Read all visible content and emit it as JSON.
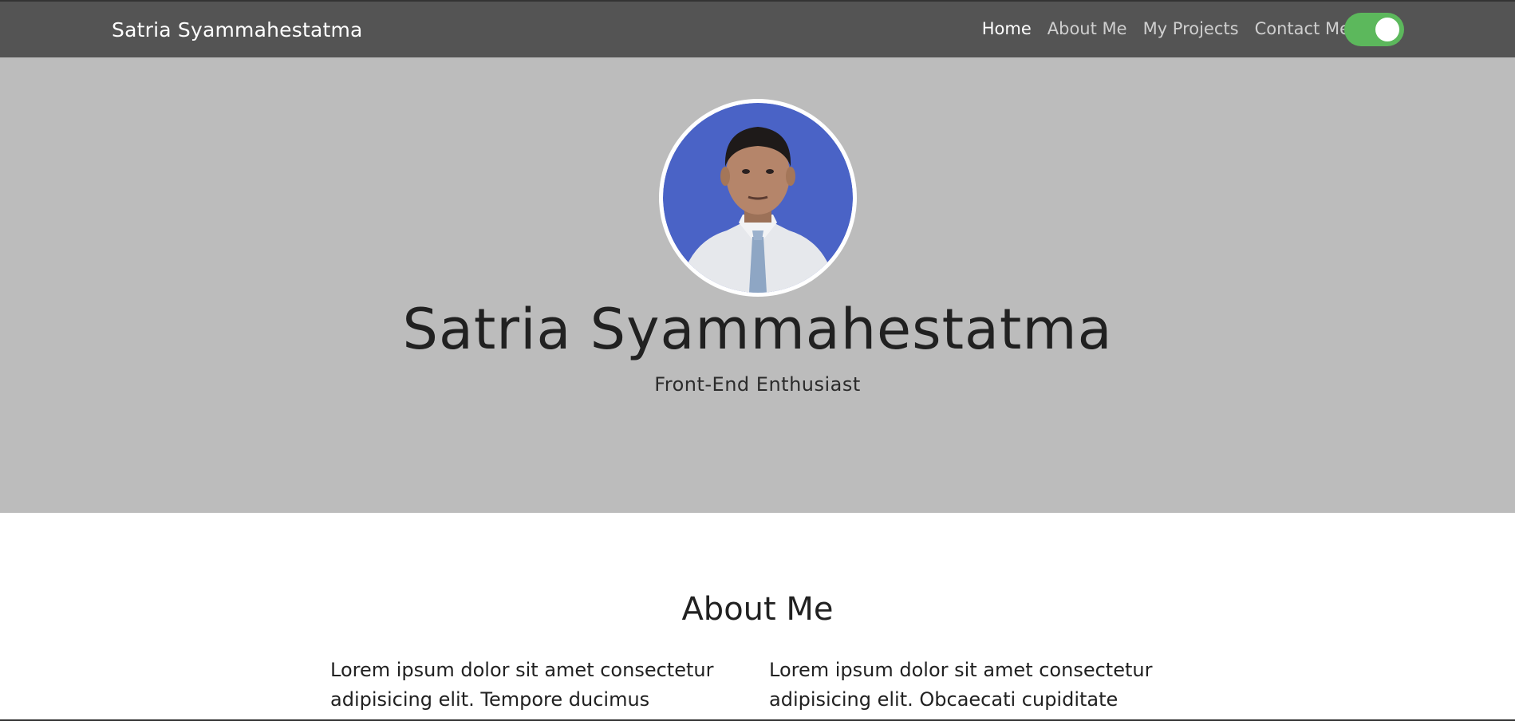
{
  "navbar": {
    "brand": "Satria Syammahestatma",
    "links": [
      {
        "label": "Home",
        "active": true
      },
      {
        "label": "About Me",
        "active": false
      },
      {
        "label": "My Projects",
        "active": false
      },
      {
        "label": "Contact Me",
        "active": false
      }
    ],
    "theme_toggle": {
      "on": true,
      "color": "#5cb85c"
    }
  },
  "hero": {
    "background": "#bcbcbc",
    "avatar_icon": "profile-photo",
    "name": "Satria Syammahestatma",
    "subtitle": "Front-End Enthusiast"
  },
  "about": {
    "title": "About Me",
    "columns": [
      "Lorem ipsum dolor sit amet consectetur adipisicing elit. Tempore ducimus",
      "Lorem ipsum dolor sit amet consectetur adipisicing elit. Obcaecati cupiditate"
    ]
  }
}
